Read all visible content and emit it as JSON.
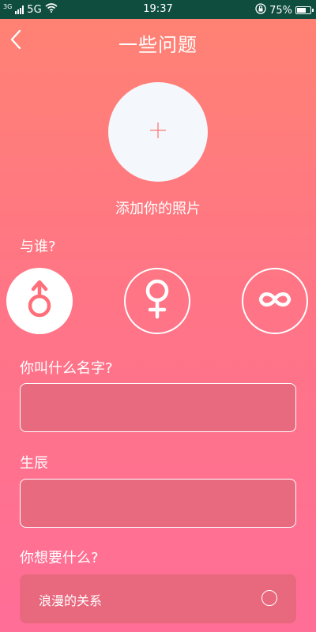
{
  "status_bar": {
    "network_small": "3G",
    "network": "5G",
    "time": "19:37",
    "battery_percent": "75%",
    "battery_level": 0.75,
    "icons": [
      "signal-icon",
      "wifi-icon",
      "rotation-lock-icon",
      "battery-icon"
    ]
  },
  "header": {
    "title": "一些问题",
    "back_icon": "chevron-left-icon"
  },
  "photo": {
    "icon": "plus-icon",
    "label": "添加你的照片"
  },
  "gender": {
    "label": "与谁?",
    "options": [
      {
        "icon": "male-icon",
        "selected": true
      },
      {
        "icon": "female-icon",
        "selected": false
      },
      {
        "icon": "infinity-icon",
        "selected": false
      }
    ]
  },
  "name_field": {
    "label": "你叫什么名字?",
    "value": ""
  },
  "birthday_field": {
    "label": "生辰",
    "value": ""
  },
  "wants": {
    "label": "你想要什么?",
    "options": [
      {
        "label": "浪漫的关系",
        "selected": false
      }
    ]
  },
  "colors": {
    "accent": "#ff6f79",
    "status_bar": "#0f4d3f",
    "field_fill": "#e86a7f"
  }
}
